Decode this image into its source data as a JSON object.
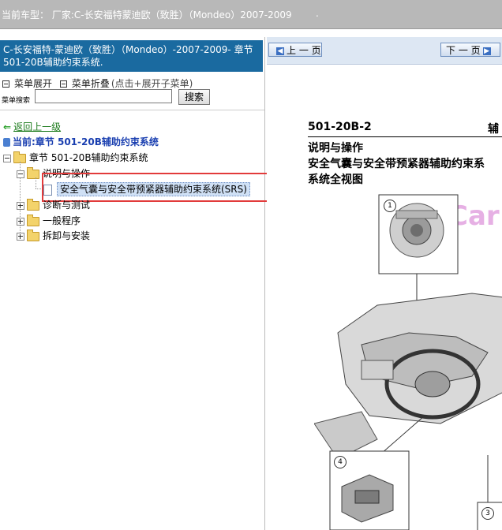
{
  "topbar": {
    "label": "当前车型：",
    "value": "厂家:C-长安福特蒙迪欧（致胜）（Mondeo）2007-2009",
    "trail": "."
  },
  "left": {
    "header": "C-长安福特-蒙迪欧（致胜）（Mondeo）-2007-2009- 章节 501-20B辅助约束系统.",
    "menu_expand": "菜单展开",
    "menu_collapse": "菜单折叠",
    "menu_hint": "(点击+展开子菜单)",
    "search_label": "菜单搜索",
    "search_value": "",
    "search_button": "搜索",
    "back_link": "返回上一级",
    "current": "当前:章节 501-20B辅助约束系统",
    "tree": {
      "root": "章节 501-20B辅助约束系统",
      "n1": "说明与操作",
      "n1_child": "安全气囊与安全带预紧器辅助约束系统(SRS)",
      "n2": "诊断与测试",
      "n3": "一般程序",
      "n4": "拆卸与安装"
    }
  },
  "right": {
    "prev_button": "上 一 页",
    "next_button": "下 一 页",
    "page_no": "501-20B-2",
    "page_right": "辅",
    "line1": "说明与操作",
    "line2": "安全气囊与安全带预紧器辅助约束系",
    "line3": "系统全视图",
    "callouts": [
      "1",
      "4",
      "3"
    ],
    "watermark": "Car"
  }
}
